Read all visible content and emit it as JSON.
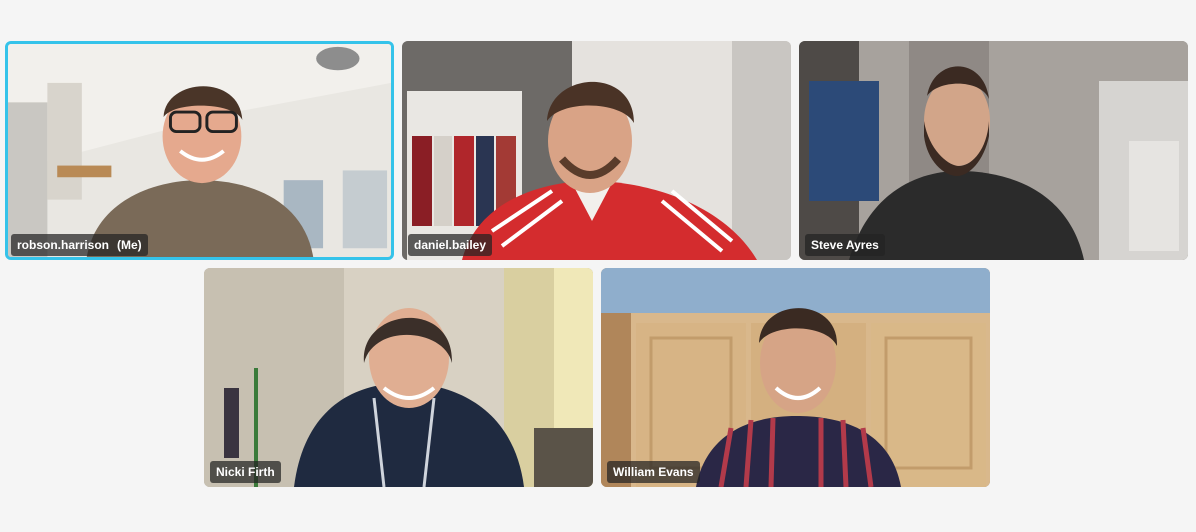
{
  "participants": [
    {
      "name": "robson.harrison",
      "suffix": "(Me)",
      "active": true
    },
    {
      "name": "daniel.bailey",
      "suffix": ""
    },
    {
      "name": "Steve Ayres",
      "suffix": ""
    },
    {
      "name": "Nicki Firth",
      "suffix": ""
    },
    {
      "name": "William Evans",
      "suffix": ""
    }
  ],
  "colors": {
    "background": "#f5f5f5",
    "active_speaker_border": "#35c3ea",
    "name_tag_bg": "#232323",
    "name_tag_text": "#ffffff"
  }
}
